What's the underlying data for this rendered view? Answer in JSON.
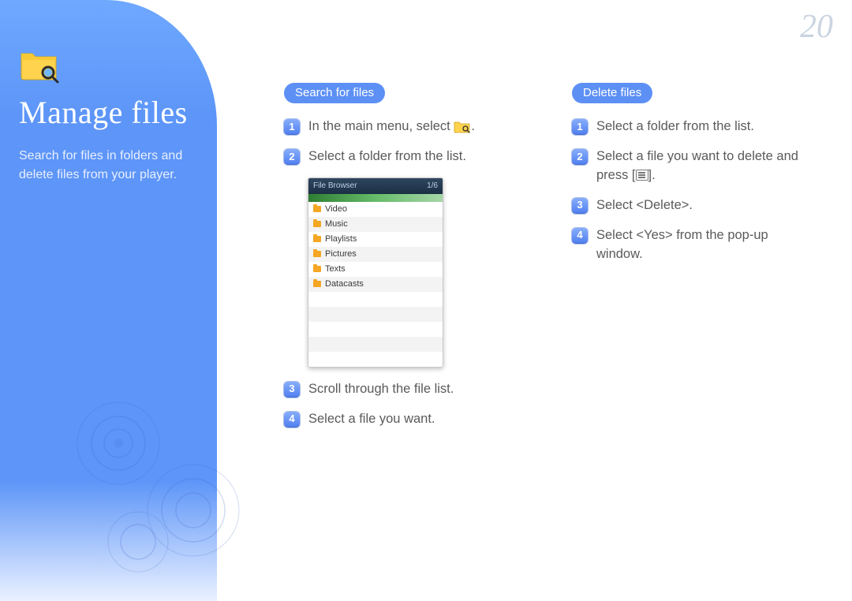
{
  "page_number": "20",
  "sidebar": {
    "title": "Manage files",
    "subtitle": "Search for files in folders and delete files from your player."
  },
  "sections": {
    "search": {
      "heading": "Search for files",
      "step1_before": "In the main menu, select ",
      "step1_after": ".",
      "step2": "Select a folder from the list.",
      "step3": "Scroll through the file list.",
      "step4": "Select a file you want."
    },
    "delete": {
      "heading": "Delete files",
      "step1": "Select a folder from the list.",
      "step2_before": "Select a file you want to delete and press [",
      "step2_after": "].",
      "step3": "Select <Delete>.",
      "step4": "Select <Yes> from the pop-up window."
    }
  },
  "filebrowser": {
    "title": "File Browser",
    "counter": "1/6",
    "items": [
      "Video",
      "Music",
      "Playlists",
      "Pictures",
      "Texts",
      "Datacasts"
    ]
  }
}
